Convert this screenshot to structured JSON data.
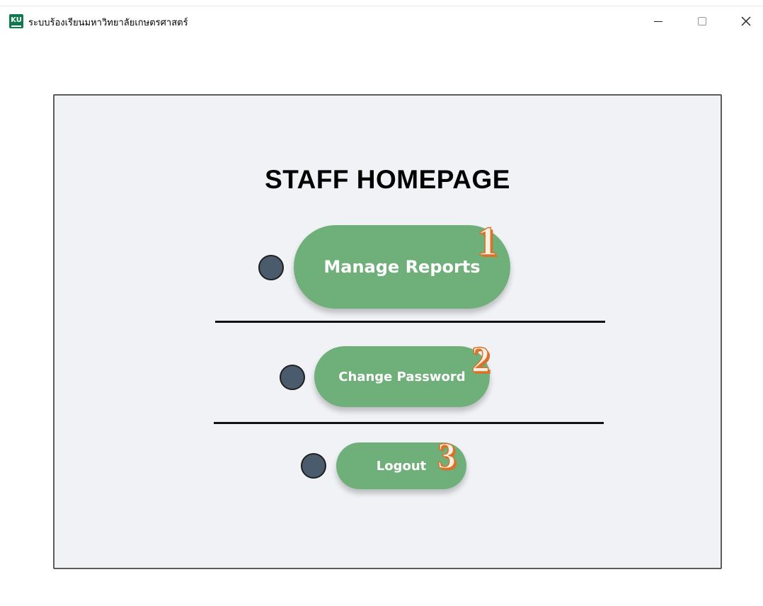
{
  "window": {
    "title": "ระบบร้องเรียนมหาวิทยาลัยเกษตรศาสตร์",
    "app_icon_text": "KU",
    "controls": {
      "minimize_icon": "minimize-icon",
      "maximize_icon": "maximize-icon",
      "close_icon": "close-icon"
    }
  },
  "page": {
    "heading": "STAFF HOMEPAGE",
    "buttons": [
      {
        "label": "Manage Reports",
        "marker": "1"
      },
      {
        "label": "Change Password",
        "marker": "2"
      },
      {
        "label": "Logout",
        "marker": "3"
      }
    ]
  },
  "colors": {
    "button_green": "#6fb07a",
    "dot_slate": "#4a5b6d",
    "marker_orange": "#d7732a",
    "panel_bg": "#f0f2f5"
  }
}
